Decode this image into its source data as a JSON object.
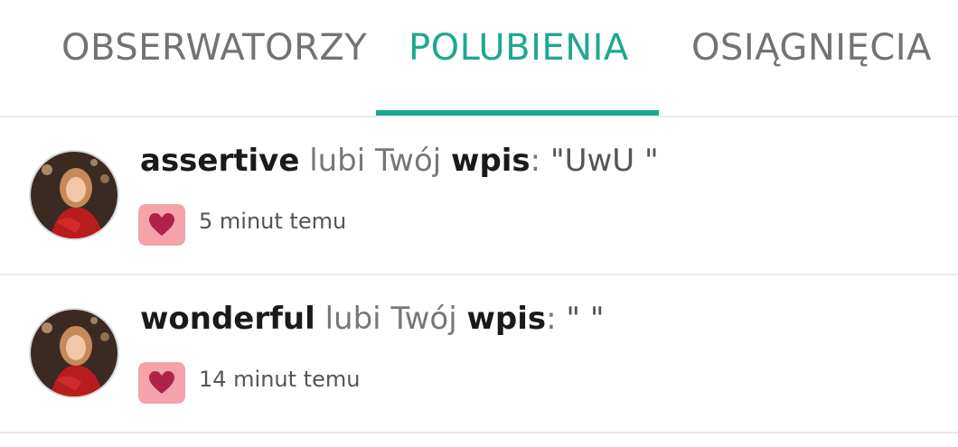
{
  "tabs": {
    "observers": "OBSERWATORZY",
    "likes": "POLUBIENIA",
    "achievements": "OSIĄGNIĘCIA"
  },
  "colors": {
    "accent": "#1fa88f",
    "heart_bg": "#f4a3ab",
    "heart": "#b0224a"
  },
  "notifications": [
    {
      "username": "assertive",
      "verb": "lubi Twój",
      "object": "wpis",
      "colon": ":",
      "quote": "\"UwU \"",
      "time": "5 minut temu",
      "icon": "heart-icon"
    },
    {
      "username": "wonderful",
      "verb": "lubi Twój",
      "object": "wpis",
      "colon": ":",
      "quote": "\" \"",
      "time": "14 minut temu",
      "icon": "heart-icon"
    }
  ]
}
